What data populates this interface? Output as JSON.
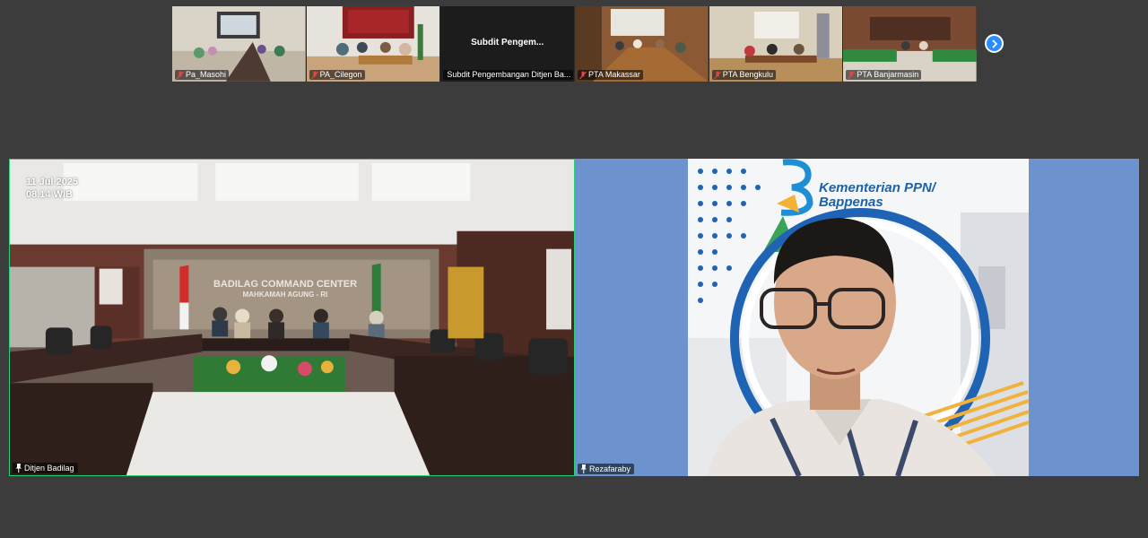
{
  "thumbnails": [
    {
      "name": "Pa_Masohi",
      "mic_muted": true
    },
    {
      "name": "PA_Cilegon",
      "mic_muted": true
    },
    {
      "name": "Subdit Pengembangan Ditjen Ba...",
      "center_label": "Subdit Pengem...",
      "mic_muted": true
    },
    {
      "name": "PTA Makassar",
      "mic_muted": true
    },
    {
      "name": "PTA Bengkulu",
      "mic_muted": true
    },
    {
      "name": "PTA Banjarmasin",
      "mic_muted": true
    }
  ],
  "main_tiles": {
    "left": {
      "name": "Ditjen Badilag",
      "date_stamp": "11 Jul 2025",
      "time_stamp": "08.14 WIB",
      "backdrop_text": "BADILAG COMMAND CENTER",
      "backdrop_subtext": "MAHKAMAH AGUNG - RI"
    },
    "right": {
      "name": "Rezafaraby",
      "background_logo_line1": "Kementerian PPN/",
      "background_logo_line2": "Bappenas"
    }
  },
  "colors": {
    "active_speaker_border": "#2bd17a",
    "next_button": "#2d8cff",
    "background": "#3c3c3c"
  }
}
